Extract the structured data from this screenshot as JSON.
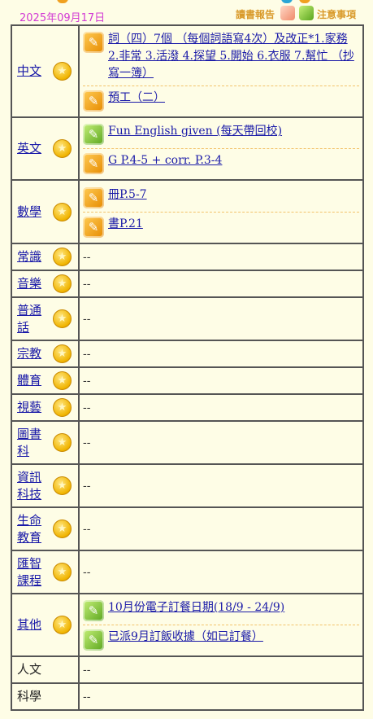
{
  "date": "2025年09月17日",
  "top_links": {
    "reading_report": "讀書報告",
    "notice": "注意事項"
  },
  "icons": {
    "homework": "pencil-note-icon",
    "notice": "pencil-note-icon",
    "subject": "star-icon"
  },
  "colors": {
    "background": "#fefde6",
    "date": "#d23ad4",
    "link": "#1a1aa8",
    "star": "#f0b400"
  },
  "rows": [
    {
      "subject": "中文",
      "tasks": [
        {
          "icon": "orange",
          "text": "詞（四）7個 （每個詞語寫4次）及改正*1.家務 2.非常 3.活潑 4.探望 5.開始 6.衣服 7.幫忙 （抄寫一簿）"
        },
        {
          "icon": "orange",
          "text": "預工（二）"
        }
      ]
    },
    {
      "subject": "英文",
      "tasks": [
        {
          "icon": "green",
          "text": "Fun English given (每天帶回校)"
        },
        {
          "icon": "orange",
          "text": "G P.4-5 + corr. P.3-4"
        }
      ]
    },
    {
      "subject": "數學",
      "tasks": [
        {
          "icon": "orange",
          "text": "冊P.5-7"
        },
        {
          "icon": "orange",
          "text": "書P.21"
        }
      ]
    },
    {
      "subject": "常識",
      "empty": "--"
    },
    {
      "subject": "音樂",
      "empty": "--"
    },
    {
      "subject": "普通話",
      "empty": "--"
    },
    {
      "subject": "宗教",
      "empty": "--"
    },
    {
      "subject": "體育",
      "empty": "--"
    },
    {
      "subject": "視藝",
      "empty": "--"
    },
    {
      "subject": "圖書科",
      "empty": "--"
    },
    {
      "subject": "資訊科技",
      "empty": "--"
    },
    {
      "subject": "生命教育",
      "empty": "--"
    },
    {
      "subject": "匯智課程",
      "empty": "--"
    },
    {
      "subject": "其他",
      "tasks": [
        {
          "icon": "green",
          "text": "10月份電子訂餐日期(18/9 - 24/9)"
        },
        {
          "icon": "green",
          "text": "已派9月訂飯收據（如已訂餐）"
        }
      ]
    },
    {
      "subject": "人文",
      "plain": true,
      "nostar": true,
      "empty": "--"
    },
    {
      "subject": "科學",
      "plain": true,
      "nostar": true,
      "empty": "--"
    }
  ]
}
